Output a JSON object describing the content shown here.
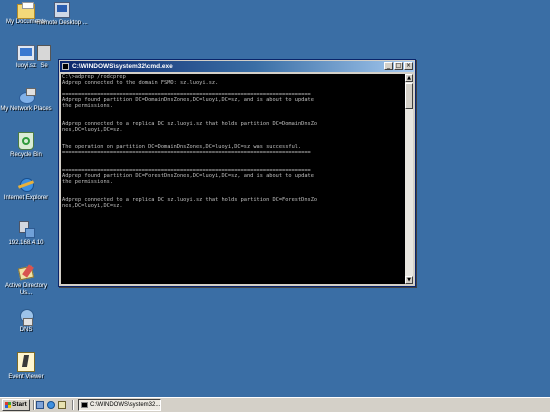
{
  "desktop": {
    "icons": [
      {
        "label": "My Documents"
      },
      {
        "label": "Remote Desktop ..."
      },
      {
        "label": "luoyi.sz"
      },
      {
        "label": "Se"
      },
      {
        "label": "My Network Places"
      },
      {
        "label": "Recycle Bin"
      },
      {
        "label": "Internet Explorer"
      },
      {
        "label": "192.168.4.10"
      },
      {
        "label": "Active Directory Us..."
      },
      {
        "label": "DNS"
      },
      {
        "label": "Event Viewer"
      }
    ]
  },
  "cmd_window": {
    "title": "C:\\WINDOWS\\system32\\cmd.exe",
    "minimize_glyph": "_",
    "maximize_glyph": "□",
    "close_glyph": "×",
    "scroll_up_glyph": "▲",
    "scroll_down_glyph": "▼",
    "lines": [
      "C:\\>adprep /rodcprep",
      "Adprep connected to the domain FSMO: sz.luoyi.sz.",
      "",
      "==============================================================================",
      "Adprep found partition DC=DomainDnsZones,DC=luoyi,DC=sz, and is about to update",
      "the permissions.",
      "",
      "",
      "Adprep connected to a replica DC sz.luoyi.sz that holds partition DC=DomainDnsZo",
      "nes,DC=luoyi,DC=sz.",
      "",
      "",
      "The operation on partition DC=DomainDnsZones,DC=luoyi,DC=sz was successful.",
      "==============================================================================",
      "",
      "",
      "==============================================================================",
      "Adprep found partition DC=ForestDnsZones,DC=luoyi,DC=sz, and is about to update",
      "the permissions.",
      "",
      "",
      "Adprep connected to a replica DC sz.luoyi.sz that holds partition DC=ForestDnsZo",
      "nes,DC=luoyi,DC=sz."
    ]
  },
  "taskbar": {
    "start_label": "Start",
    "task_label": "C:\\WINDOWS\\system32..."
  }
}
